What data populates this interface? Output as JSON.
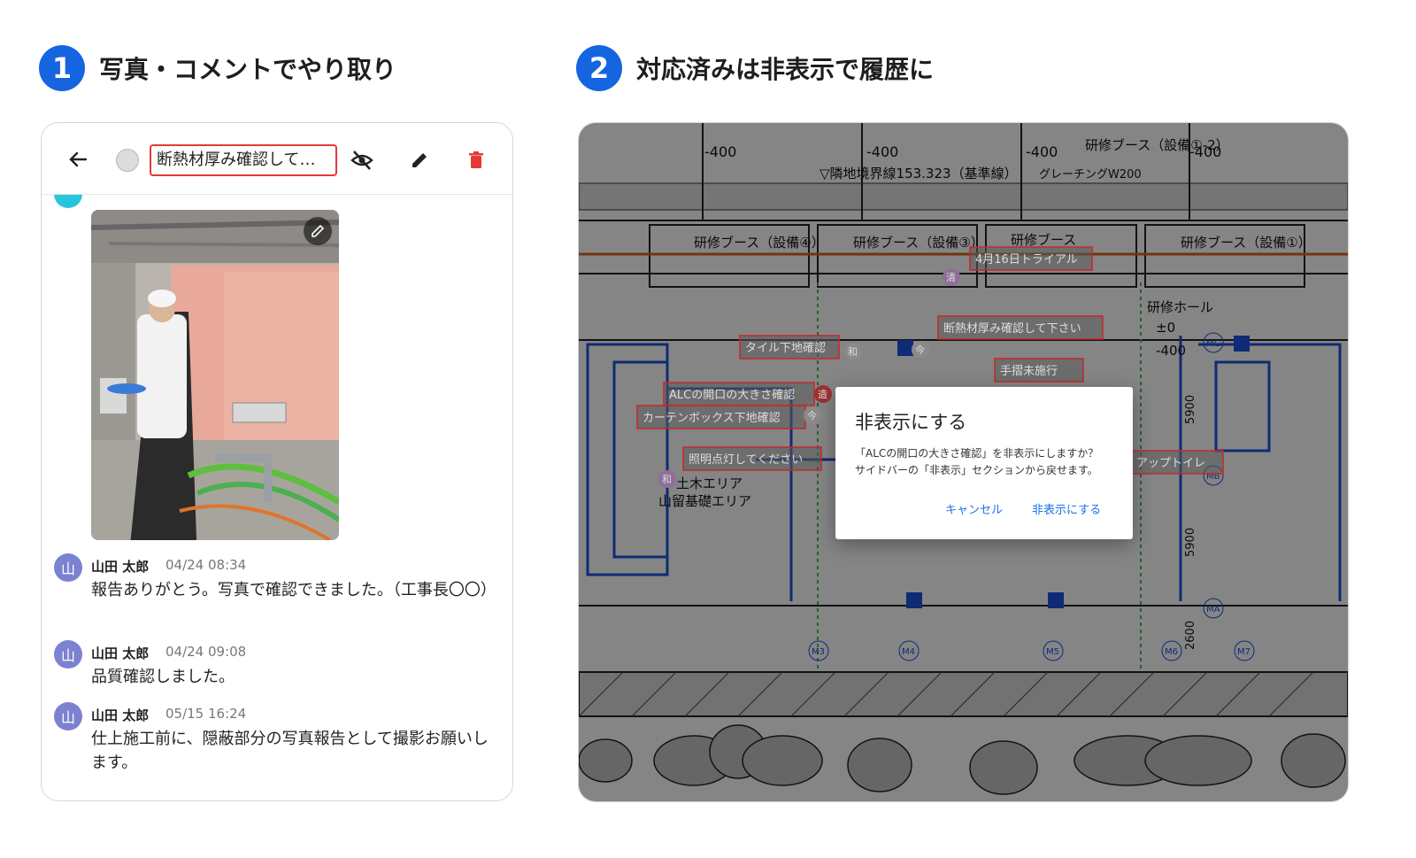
{
  "steps": [
    {
      "number": "1",
      "title": "写真・コメントでやり取り"
    },
    {
      "number": "2",
      "title": "対応済みは非表示で履歴に"
    }
  ],
  "panel1": {
    "title_field": "断熱材厚み確認して…",
    "icons": [
      "back-arrow-icon",
      "hide-eye-icon",
      "pencil-icon",
      "trash-icon"
    ],
    "comments": [
      {
        "avatar": "山",
        "name": "山田 太郎",
        "time": "04/24 08:34",
        "text": "報告ありがとう。写真で確認できました。（工事長〇〇）"
      },
      {
        "avatar": "山",
        "name": "山田 太郎",
        "time": "04/24 09:08",
        "text": "品質確認しました。"
      },
      {
        "avatar": "山",
        "name": "山田 太郎",
        "time": "05/15 16:24",
        "text": "仕上施工前に、隠蔽部分の写真報告として撮影お願いします。"
      }
    ]
  },
  "panel2": {
    "drawing_texts": {
      "level_1": "-400",
      "level_2": "-400",
      "level_3": "-400",
      "level_4": "-400",
      "ground_line": "▽隣地境界線153.323（基準線）",
      "grating": "グレーチングW200",
      "booth_1": "研修ブース（設備④）",
      "booth_2": "研修ブース（設備③）",
      "booth_3": "研修ブース",
      "booth_4": "研修ブース（設備①）",
      "booth_top": "研修ブース（設備①-2）",
      "hall": "研修ホール",
      "hall_level": "±0",
      "hall_level2": "-400",
      "area_1": "土木エリア",
      "area_2": "山留基礎エリア",
      "dim_1": "5900",
      "dim_2": "5900",
      "dim_3": "2600",
      "axis_m3": "M3",
      "axis_m4": "M4",
      "axis_m5": "M5",
      "axis_m6": "M6",
      "axis_m7": "M7",
      "axis_ma": "MA",
      "axis_mb": "MB",
      "axis_mc": "MC"
    },
    "pins": [
      "4月16日トライアル",
      "断熱材厚み確認して下さい",
      "タイル下地確認",
      "手摺未施行",
      "ALCの開口の大きさ確認",
      "カーテンボックス下地確認",
      "照明点灯してください",
      "アップトイレ"
    ],
    "pin_badges": [
      "和",
      "今",
      "清",
      "造",
      "今",
      "和"
    ],
    "dialog": {
      "title": "非表示にする",
      "body_line1": "「ALCの開口の大きさ確認」を非表示にしますか？",
      "body_line2": "サイドバーの「非表示」セクションから戻せます。",
      "cancel": "キャンセル",
      "confirm": "非表示にする"
    }
  },
  "colors": {
    "accent": "#1565e0",
    "danger": "#e53935",
    "avatar": "#7b82d1",
    "link": "#1a73e8"
  }
}
